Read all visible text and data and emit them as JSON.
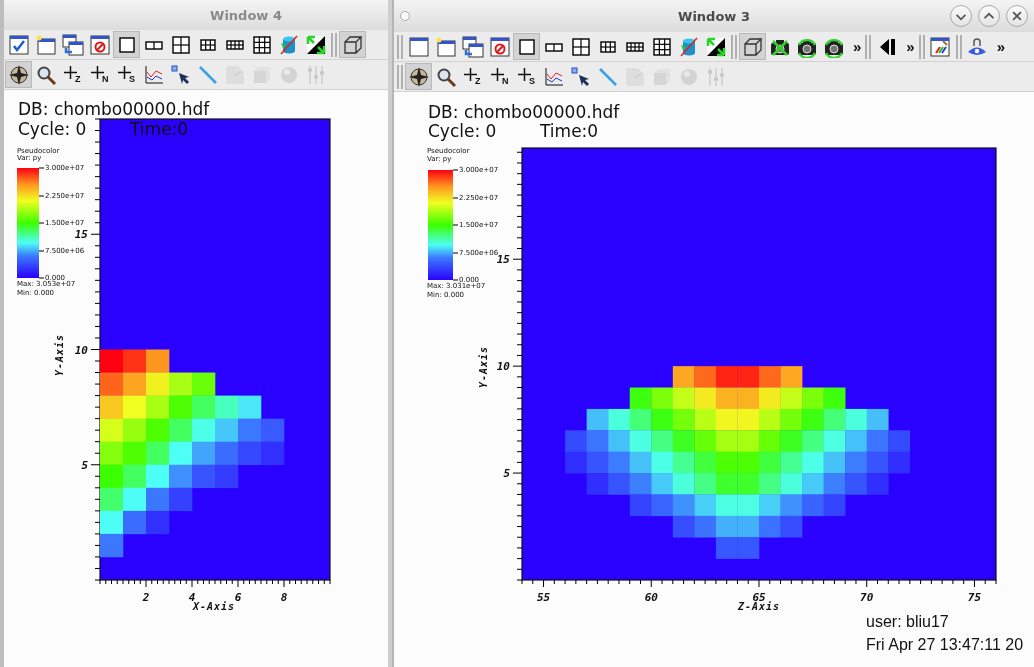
{
  "windows": [
    {
      "title": "Window 4",
      "active": false,
      "title_buttons": false,
      "toolbars": [
        [
          {
            "kind": "window-check",
            "pressed": false,
            "disabled": false
          },
          {
            "kind": "window-new",
            "pressed": false,
            "disabled": false
          },
          {
            "kind": "window-copy",
            "pressed": false,
            "disabled": false
          },
          {
            "kind": "window-clear",
            "pressed": false,
            "disabled": false
          },
          {
            "kind": "layout-1",
            "pressed": true,
            "disabled": false
          },
          {
            "kind": "layout-2",
            "pressed": false,
            "disabled": false
          },
          {
            "kind": "layout-4",
            "pressed": false,
            "disabled": false
          },
          {
            "kind": "layout-6",
            "pressed": false,
            "disabled": false
          },
          {
            "kind": "layout-8",
            "pressed": false,
            "disabled": false
          },
          {
            "kind": "layout-9",
            "pressed": false,
            "disabled": false
          },
          {
            "kind": "cylinder-crossed",
            "pressed": false,
            "disabled": false
          },
          {
            "kind": "triangle-arrows",
            "pressed": false,
            "disabled": false
          },
          {
            "kind": "grip"
          },
          {
            "kind": "box-3d",
            "pressed": true,
            "disabled": false
          }
        ],
        [
          {
            "kind": "compass",
            "pressed": true,
            "disabled": false
          },
          {
            "kind": "magnifier",
            "pressed": false,
            "disabled": false
          },
          {
            "kind": "add-point",
            "label": "Z",
            "pressed": false,
            "disabled": false
          },
          {
            "kind": "add-point",
            "label": "N",
            "pressed": false,
            "disabled": false
          },
          {
            "kind": "add-point",
            "label": "S",
            "pressed": false,
            "disabled": false
          },
          {
            "kind": "curve-chart",
            "pressed": false,
            "disabled": false
          },
          {
            "kind": "pick-arrow",
            "pressed": false,
            "disabled": false
          },
          {
            "kind": "line-tool",
            "pressed": false,
            "disabled": false
          },
          {
            "kind": "page",
            "pressed": false,
            "disabled": true
          },
          {
            "kind": "cube",
            "pressed": false,
            "disabled": true
          },
          {
            "kind": "sphere",
            "pressed": false,
            "disabled": true
          },
          {
            "kind": "sliders",
            "pressed": false,
            "disabled": true
          }
        ]
      ],
      "plot": {
        "kind": "corner",
        "db": "DB: chombo00000.hdf",
        "cycle": "Cycle: 0",
        "time": "Time:0",
        "legend": {
          "title": "Pseudocolor",
          "variable": "Var: py",
          "labels": [
            "3.000e+07",
            "2.250e+07",
            "1.500e+07",
            "7.500e+06",
            "0.000"
          ],
          "max": "Max: 3.053e+07",
          "min": "Min: 0.000"
        },
        "x_axis": {
          "title": "X-Axis",
          "ticks": [
            "2",
            "4",
            "6",
            "8"
          ]
        },
        "y_axis": {
          "title": "Y-Axis",
          "ticks": [
            "15",
            "10",
            "5"
          ]
        }
      }
    },
    {
      "title": "Window 3",
      "active": true,
      "title_buttons": true,
      "toolbars": [
        [
          {
            "kind": "grip"
          },
          {
            "kind": "window",
            "pressed": false,
            "disabled": false
          },
          {
            "kind": "window-new",
            "pressed": false,
            "disabled": false
          },
          {
            "kind": "window-copy",
            "pressed": false,
            "disabled": false
          },
          {
            "kind": "window-clear",
            "pressed": false,
            "disabled": false
          },
          {
            "kind": "layout-1",
            "pressed": true,
            "disabled": false
          },
          {
            "kind": "layout-2",
            "pressed": false,
            "disabled": false
          },
          {
            "kind": "layout-4",
            "pressed": false,
            "disabled": false
          },
          {
            "kind": "layout-6",
            "pressed": false,
            "disabled": false
          },
          {
            "kind": "layout-8",
            "pressed": false,
            "disabled": false
          },
          {
            "kind": "layout-9",
            "pressed": false,
            "disabled": false
          },
          {
            "kind": "cylinder-crossed",
            "pressed": false,
            "disabled": false
          },
          {
            "kind": "triangle-arrows",
            "pressed": false,
            "disabled": false
          },
          {
            "kind": "grip"
          },
          {
            "kind": "box-3d",
            "pressed": true,
            "disabled": false
          },
          {
            "kind": "camera-cross",
            "pressed": false,
            "disabled": false
          },
          {
            "kind": "camera-arrows",
            "pressed": false,
            "disabled": false
          },
          {
            "kind": "camera-arrows",
            "pressed": false,
            "disabled": false
          },
          {
            "kind": "overflow",
            "text": "»"
          },
          {
            "kind": "grip"
          },
          {
            "kind": "step-back",
            "pressed": false,
            "disabled": false
          },
          {
            "kind": "overflow",
            "text": "»"
          },
          {
            "kind": "grip"
          },
          {
            "kind": "paint-window",
            "pressed": false,
            "disabled": false
          },
          {
            "kind": "grip"
          },
          {
            "kind": "eye-lock",
            "pressed": false,
            "disabled": false
          },
          {
            "kind": "overflow",
            "text": "»"
          }
        ],
        [
          {
            "kind": "grip"
          },
          {
            "kind": "compass",
            "pressed": true,
            "disabled": false
          },
          {
            "kind": "magnifier",
            "pressed": false,
            "disabled": false
          },
          {
            "kind": "add-point",
            "label": "Z",
            "pressed": false,
            "disabled": false
          },
          {
            "kind": "add-point",
            "label": "N",
            "pressed": false,
            "disabled": false
          },
          {
            "kind": "add-point",
            "label": "S",
            "pressed": false,
            "disabled": false
          },
          {
            "kind": "curve-chart",
            "pressed": false,
            "disabled": false
          },
          {
            "kind": "pick-arrow",
            "pressed": false,
            "disabled": false
          },
          {
            "kind": "line-tool",
            "pressed": false,
            "disabled": false
          },
          {
            "kind": "page",
            "pressed": false,
            "disabled": true
          },
          {
            "kind": "cube",
            "pressed": false,
            "disabled": true
          },
          {
            "kind": "sphere",
            "pressed": false,
            "disabled": true
          },
          {
            "kind": "sliders",
            "pressed": false,
            "disabled": true
          }
        ]
      ],
      "plot": {
        "kind": "centered",
        "db": "DB: chombo00000.hdf",
        "cycle": "Cycle: 0",
        "time": "Time:0",
        "legend": {
          "title": "Pseudocolor",
          "variable": "Var: py",
          "labels": [
            "3.000e+07",
            "2.250e+07",
            "1.500e+07",
            "7.500e+06",
            "0.000"
          ],
          "max": "Max: 3.031e+07",
          "min": "Min: 0.000"
        },
        "x_axis": {
          "title": "Z-Axis",
          "ticks": [
            "55",
            "60",
            "65",
            "70",
            "75"
          ]
        },
        "y_axis": {
          "title": "Y-Axis",
          "ticks": [
            "15",
            "10",
            "5"
          ]
        },
        "user": "user: bliu17",
        "date": "Fri Apr 27 13:47:11 20"
      }
    }
  ]
}
